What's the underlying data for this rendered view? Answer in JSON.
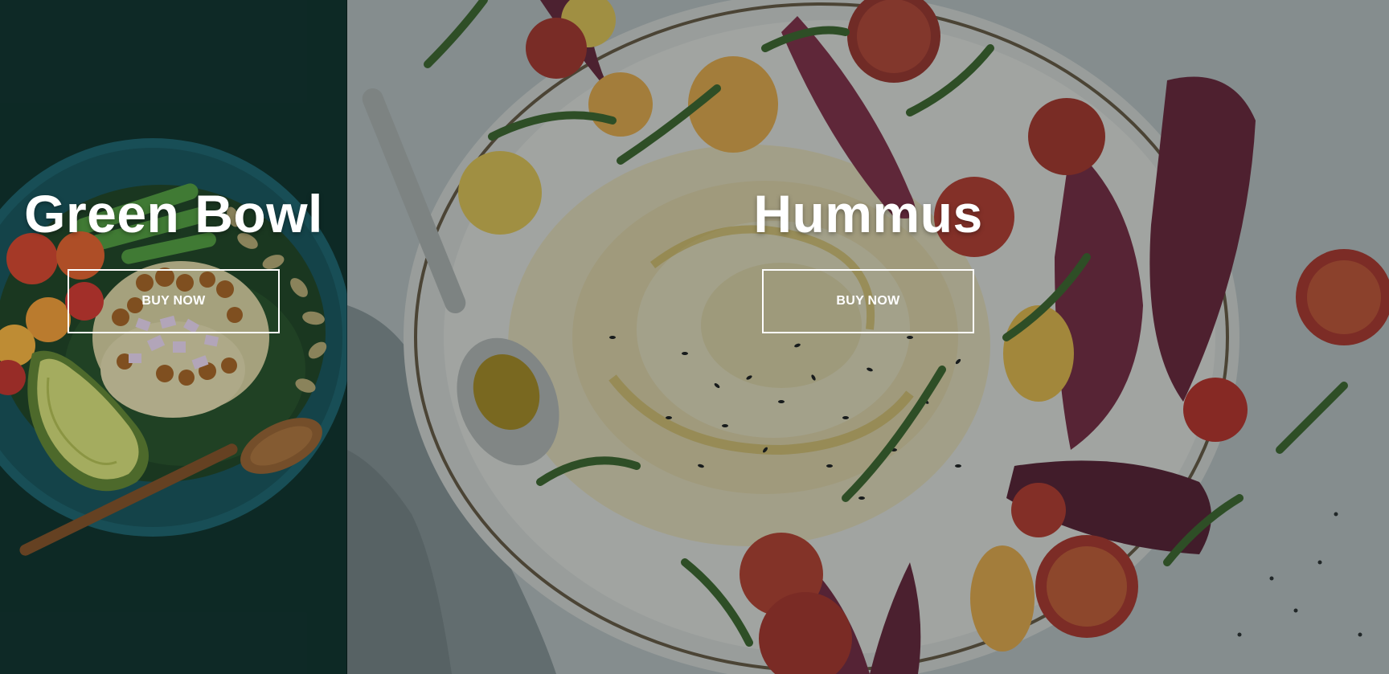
{
  "panels": [
    {
      "title": "Green Bowl",
      "button_label": "BUY NOW",
      "background_color": "#0e2a26",
      "image": "green-bowl-food-photo"
    },
    {
      "title": "Hummus",
      "button_label": "BUY NOW",
      "background_color": "#8e979a",
      "image": "hummus-plate-food-photo"
    }
  ]
}
